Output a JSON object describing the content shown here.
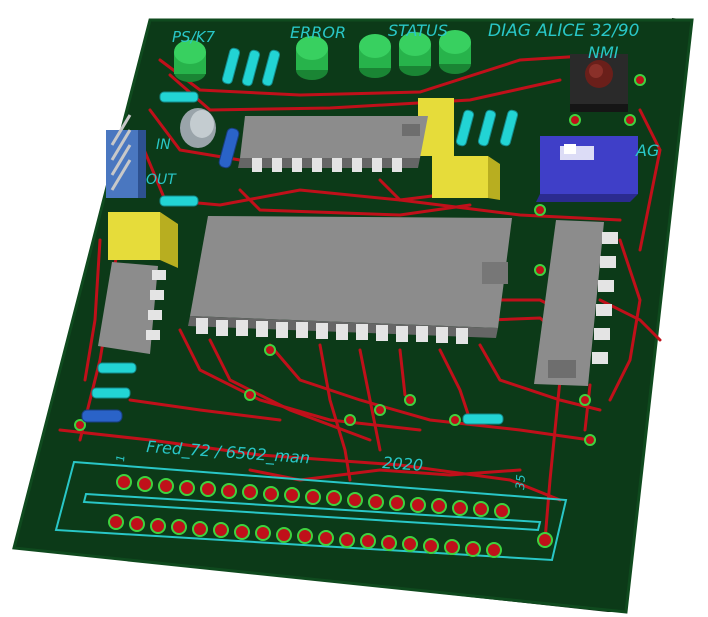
{
  "board": {
    "substrate_color": "#0c3a18",
    "copper_color": "#c0101a",
    "silk_color": "#29c7c7",
    "led_color": "#27b34b",
    "ic_color": "#8c8c8c",
    "pin_color": "#e4e4e4",
    "pad_color": "#3fd23f"
  },
  "silkscreen": {
    "ps_k7": "PS/K7",
    "error": "ERROR",
    "status": "STATUS",
    "diag_alice": "DIAG ALICE 32/90",
    "nmi": "NMI",
    "in": "IN",
    "out": "OUT",
    "diag_suffix": "AG",
    "credits": "Fred_72 / 6502_man",
    "year": "2020",
    "pin_1": "1",
    "pin_35": "35"
  }
}
